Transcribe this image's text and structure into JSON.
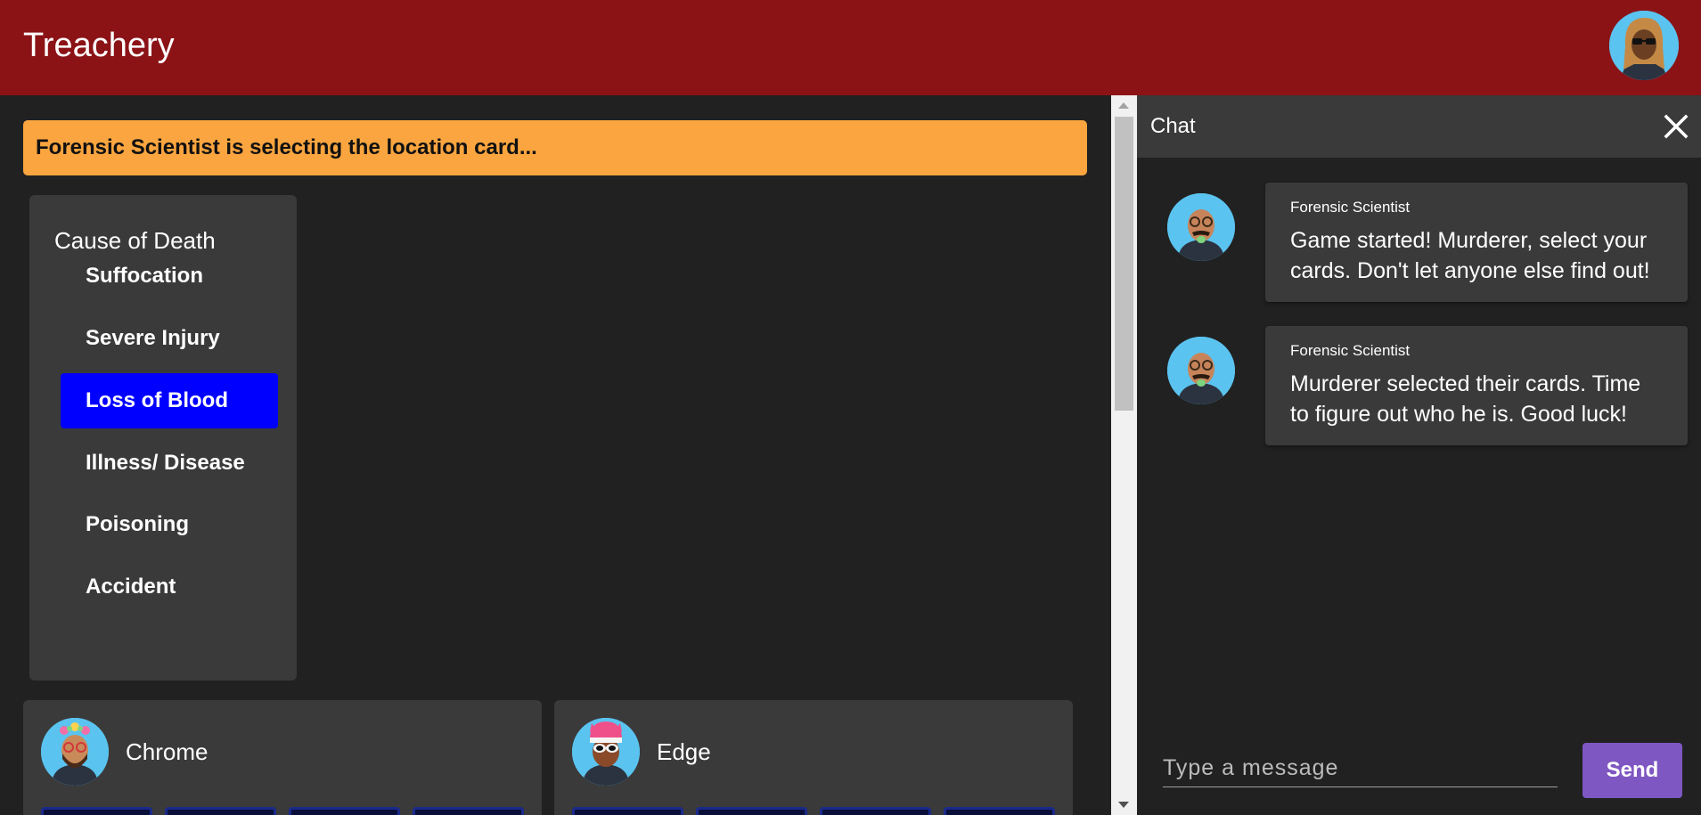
{
  "app": {
    "title": "Treachery"
  },
  "colors": {
    "appbar": "#8b1316",
    "banner": "#faa53f",
    "selected": "#0000ff",
    "send": "#7e57c2",
    "panel": "#3a3a3a",
    "background": "#212121"
  },
  "status": {
    "message": "Forensic Scientist is selecting the location card..."
  },
  "cause_panel": {
    "title": "Cause of Death",
    "items": [
      {
        "label": "Suffocation",
        "selected": false
      },
      {
        "label": "Severe Injury",
        "selected": false
      },
      {
        "label": "Loss of Blood",
        "selected": true
      },
      {
        "label": "Illness/ Disease",
        "selected": false
      },
      {
        "label": "Poisoning",
        "selected": false
      },
      {
        "label": "Accident",
        "selected": false
      }
    ]
  },
  "players": [
    {
      "name": "Chrome",
      "avatar": "avatar-icon"
    },
    {
      "name": "Edge",
      "avatar": "avatar-icon"
    }
  ],
  "chat": {
    "title": "Chat",
    "messages": [
      {
        "author": "Forensic Scientist",
        "text": "Game started! Murderer, select your cards. Don't let anyone else find out!"
      },
      {
        "author": "Forensic Scientist",
        "text": "Murderer selected their cards. Time to figure out who he is. Good luck!"
      }
    ],
    "input_placeholder": "Type a message",
    "input_value": "",
    "send_label": "Send"
  }
}
